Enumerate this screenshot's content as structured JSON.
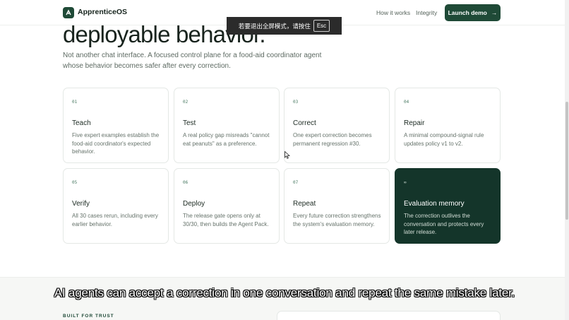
{
  "header": {
    "brand": "ApprenticeOS",
    "nav": [
      "How it works",
      "Integrity"
    ],
    "cta_label": "Launch demo",
    "cta_arrow": "→"
  },
  "hero": {
    "headline": "deployable behavior.",
    "subtext": "Not another chat interface. A focused control plane for a food-aid coordinator agent whose behavior becomes safer after every correction."
  },
  "fullscreen_toast": {
    "text": "若要退出全屏模式，请按住",
    "key": "Esc"
  },
  "steps": [
    {
      "num": "01",
      "title": "Teach",
      "desc": "Five expert examples establish the food-aid coordinator's expected behavior."
    },
    {
      "num": "02",
      "title": "Test",
      "desc": "A real policy gap misreads \"cannot eat peanuts\" as a preference."
    },
    {
      "num": "03",
      "title": "Correct",
      "desc": "One expert correction becomes permanent regression #30."
    },
    {
      "num": "04",
      "title": "Repair",
      "desc": "A minimal compound-signal rule updates policy v1 to v2."
    },
    {
      "num": "05",
      "title": "Verify",
      "desc": "All 30 cases rerun, including every earlier behavior."
    },
    {
      "num": "06",
      "title": "Deploy",
      "desc": "The release gate opens only at 30/30, then builds the Agent Pack."
    },
    {
      "num": "07",
      "title": "Repeat",
      "desc": "Every future correction strengthens the system's evaluation memory."
    },
    {
      "num": "∞",
      "title": "Evaluation memory",
      "desc": "The correction outlives the conversation and protects every later release."
    }
  ],
  "trust_section": {
    "label": "BUILT FOR TRUST"
  },
  "caption": "AI agents can accept a correction in one conversation and repeat the same mistake later.",
  "colors": {
    "accent": "#1f4a37",
    "dark_card": "#14352a"
  }
}
